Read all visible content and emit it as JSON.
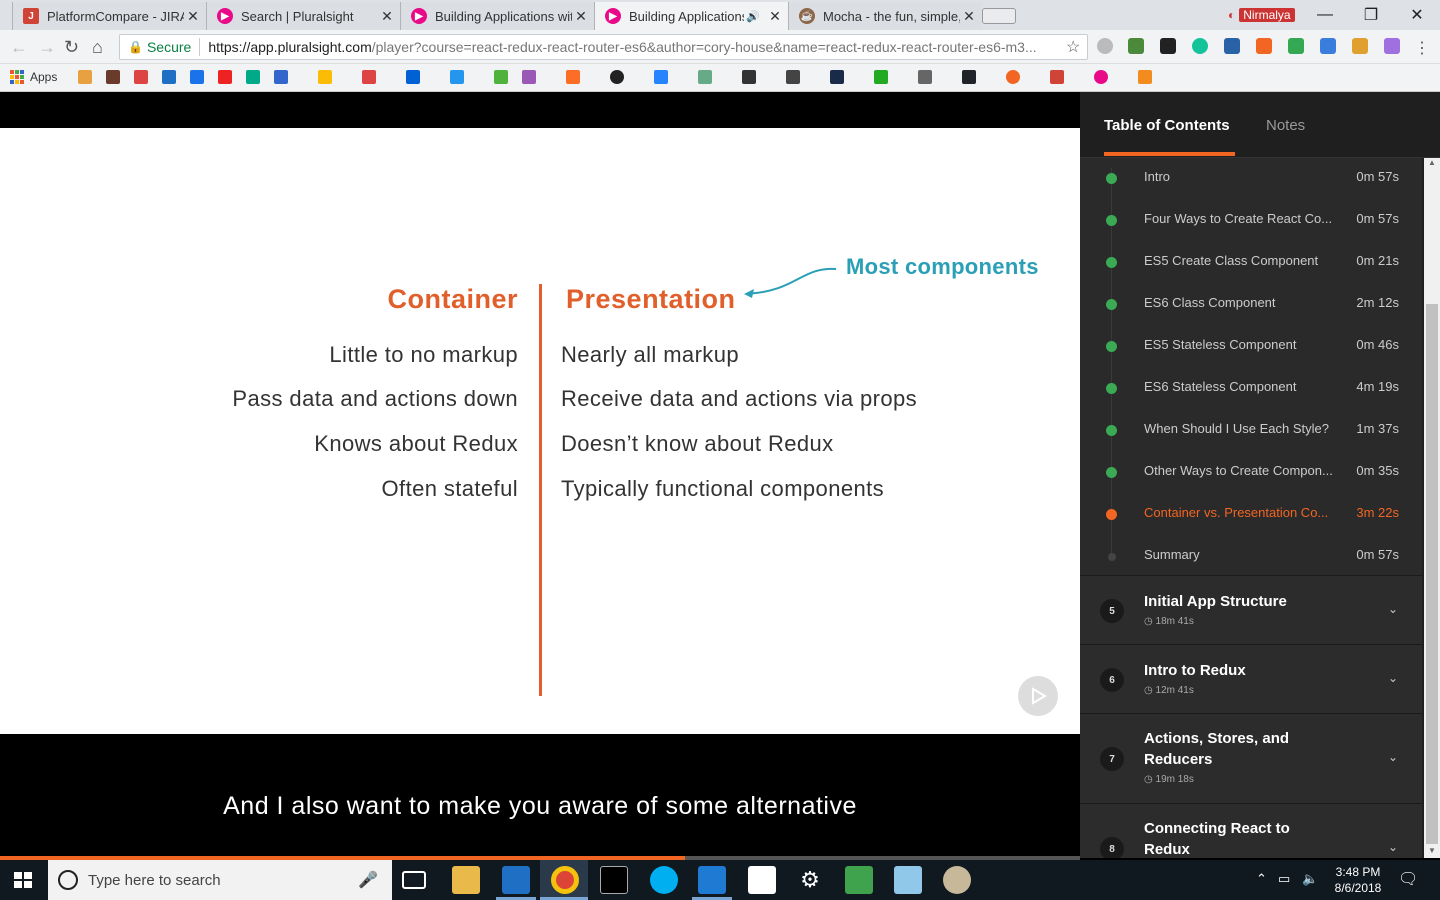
{
  "browser": {
    "tabs": [
      {
        "title": "PlatformCompare - JIRA",
        "icon": "jira-icon",
        "color": "#d04437"
      },
      {
        "title": "Search | Pluralsight",
        "icon": "pluralsight-icon",
        "color": "#e80a89"
      },
      {
        "title": "Building Applications wit",
        "icon": "pluralsight-icon",
        "color": "#e80a89"
      },
      {
        "title": "Building Applications",
        "icon": "pluralsight-icon",
        "color": "#e80a89"
      },
      {
        "title": "Mocha - the fun, simple, ",
        "icon": "mocha-icon",
        "color": "#8d6748"
      }
    ],
    "profile": "Nirmalya",
    "url_secure": "Secure",
    "url_host": "https://app.pluralsight.com",
    "url_path": "/player?course=react-redux-react-router-es6&author=cory-house&name=react-redux-react-router-es6-m3...",
    "apps_label": "Apps"
  },
  "slide": {
    "left_header": "Container",
    "right_header": "Presentation",
    "annotation": "Most components",
    "left_rows": [
      "Little to no markup",
      "Pass data and actions down",
      "Knows about Redux",
      "Often stateful"
    ],
    "right_rows": [
      "Nearly all markup",
      "Receive data and actions via props",
      "Doesn’t know about Redux",
      "Typically functional components"
    ]
  },
  "caption": "And I also want to make you aware of some alternative",
  "progress_fraction": 0.634,
  "toc": {
    "tab_contents": "Table of Contents",
    "tab_notes": "Notes",
    "clips": [
      {
        "name": "Intro",
        "dur": "0m 57s",
        "state": "done"
      },
      {
        "name": "Four Ways to Create React Co...",
        "dur": "0m 57s",
        "state": "done"
      },
      {
        "name": "ES5 Create Class Component",
        "dur": "0m 21s",
        "state": "done"
      },
      {
        "name": "ES6 Class Component",
        "dur": "2m 12s",
        "state": "done"
      },
      {
        "name": "ES5 Stateless Component",
        "dur": "0m 46s",
        "state": "done"
      },
      {
        "name": "ES6 Stateless Component",
        "dur": "4m 19s",
        "state": "done"
      },
      {
        "name": "When Should I Use Each Style?",
        "dur": "1m 37s",
        "state": "done"
      },
      {
        "name": "Other Ways to Create Compon...",
        "dur": "0m 35s",
        "state": "done"
      },
      {
        "name": "Container vs. Presentation Co...",
        "dur": "3m 22s",
        "state": "current"
      },
      {
        "name": "Summary",
        "dur": "0m 57s",
        "state": "todo"
      }
    ],
    "modules": [
      {
        "num": "5",
        "title": "Initial App Structure",
        "dur": "18m 41s"
      },
      {
        "num": "6",
        "title": "Intro to Redux",
        "dur": "12m 41s"
      },
      {
        "num": "7",
        "title": "Actions, Stores, and Reducers",
        "dur": "19m 18s"
      },
      {
        "num": "8",
        "title": "Connecting React to Redux",
        "dur": ""
      }
    ]
  },
  "taskbar": {
    "search_placeholder": "Type here to search",
    "time": "3:48 PM",
    "date": "8/6/2018"
  }
}
